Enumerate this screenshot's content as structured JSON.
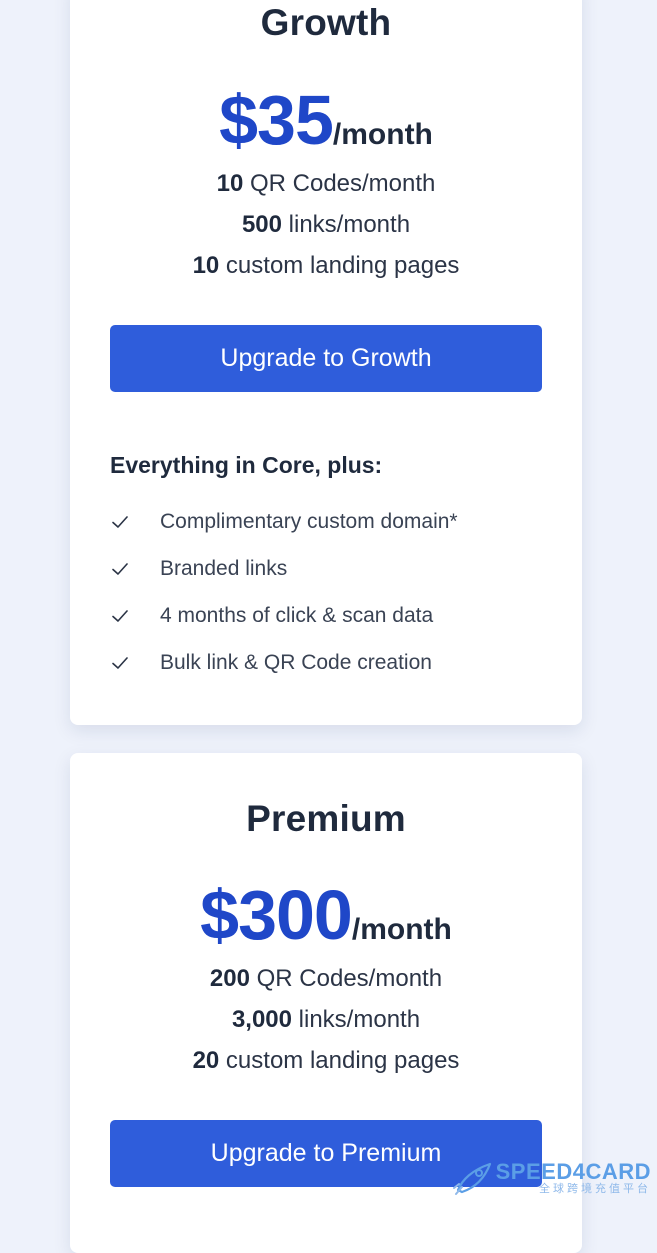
{
  "growth": {
    "name": "Growth",
    "price": "$35",
    "period": "/month",
    "quotas": [
      {
        "amount": "10",
        "label": " QR Codes/month"
      },
      {
        "amount": "500",
        "label": " links/month"
      },
      {
        "amount": "10",
        "label": " custom landing pages"
      }
    ],
    "cta_label": "Upgrade to Growth",
    "features_title": "Everything in Core, plus:",
    "features": [
      "Complimentary custom domain*",
      "Branded links",
      "4 months of click & scan data",
      "Bulk link & QR Code creation"
    ]
  },
  "premium": {
    "name": "Premium",
    "price": "$300",
    "period": "/month",
    "quotas": [
      {
        "amount": "200",
        "label": " QR Codes/month"
      },
      {
        "amount": "3,000",
        "label": " links/month"
      },
      {
        "amount": "20",
        "label": " custom landing pages"
      }
    ],
    "cta_label": "Upgrade to Premium"
  },
  "watermark": {
    "brand": "SPEED4CARD",
    "sub": "全球跨境充值平台"
  },
  "colors": {
    "accent": "#2f5ddb",
    "price": "#1f47c8",
    "background": "#eef2fb"
  },
  "icons": {
    "feature_check": "check-icon",
    "watermark_logo": "rocket-icon"
  }
}
